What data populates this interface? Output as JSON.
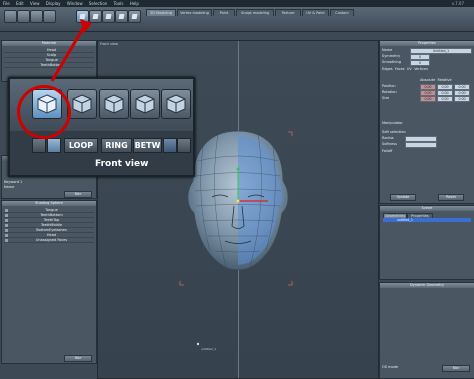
{
  "menubar": {
    "items": [
      "File",
      "Edit",
      "View",
      "Display",
      "Window",
      "Selection",
      "Tools",
      "Help"
    ],
    "version": "v.7.07"
  },
  "toolbar": {
    "icons": [
      "select-icon",
      "move-icon",
      "rotate-icon",
      "scale-icon",
      "cube-icon",
      "cube-icon",
      "cube-icon",
      "cube-icon",
      "cube-icon"
    ],
    "tabs": [
      {
        "label": "3D Modeling",
        "active": true
      },
      {
        "label": "Vertex modeling",
        "active": false
      },
      {
        "label": "Paint",
        "active": false
      },
      {
        "label": "Sculpt modeling",
        "active": false
      },
      {
        "label": "Texture",
        "active": false
      },
      {
        "label": "UV & Paint",
        "active": false
      },
      {
        "label": "Custom",
        "active": false
      }
    ]
  },
  "left_top_panel": {
    "title": "Material",
    "items": [
      "Head",
      "Scalp",
      "Tongue",
      "TeethBottom"
    ]
  },
  "left_mid_panel": {
    "items": [
      "Keyword 1",
      "Name"
    ],
    "button": "Nbr"
  },
  "shading_panel": {
    "title": "Shading Sphere",
    "items": [
      "Tongue",
      "TeethBottom",
      "TeethTop",
      "TeethMiddle",
      "BottomEyelashes",
      "Head",
      "Unassigned Faces"
    ],
    "button": "Nbr"
  },
  "viewport": {
    "label": "Front view",
    "bottom_label": "untitled_1"
  },
  "inset": {
    "buttons": [
      "LOOP",
      "RING",
      "BETW"
    ],
    "front_view_label": "Front view"
  },
  "properties": {
    "title": "Properties",
    "rows": [
      {
        "label": "Name",
        "value": "Untitled_1"
      },
      {
        "label": "Symmetry",
        "value": "X"
      },
      {
        "label": "Smoothing",
        "value": "0"
      }
    ],
    "checks": [
      "Edges",
      "Faces",
      "UV",
      "Vertices"
    ],
    "transform": [
      {
        "label": "Position",
        "x": "0.00",
        "y": "0.00",
        "z": "0.00"
      },
      {
        "label": "Rotation",
        "x": "0.00",
        "y": "0.00",
        "z": "0.00"
      },
      {
        "label": "Size",
        "x": "0.00",
        "y": "0.00",
        "z": "0.00"
      }
    ],
    "mode": [
      "Absolute",
      "Relative"
    ],
    "manipulator": "Manipulator",
    "soft_selection": "Soft selection",
    "radius_label": "Radius",
    "softness_label": "Softness",
    "falloff": "Falloff",
    "buttons": [
      "Update",
      "Reset"
    ]
  },
  "scene": {
    "title": "Scene",
    "tabs": [
      "Geometries",
      "Properties"
    ],
    "selected_item": "untitled_1"
  },
  "dynamic": {
    "title": "Dynamic Geometry",
    "footer": "OS mode",
    "button": "Nbr"
  }
}
